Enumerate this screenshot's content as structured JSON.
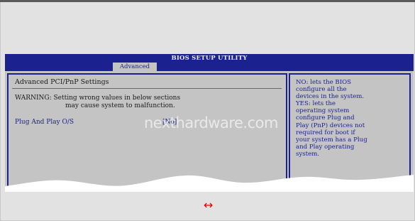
{
  "bios": {
    "title": "BIOS SETUP UTILITY",
    "active_tab": "Advanced",
    "heading": "Advanced PCI/PnP Settings",
    "warning_line1": "WARNING: Setting wrong values in below sections",
    "warning_line2": "may cause system to malfunction.",
    "setting_label": "Plug And Play O/S",
    "setting_value": "[No]",
    "help_lines": [
      "NO: lets the BIOS",
      "configure all the",
      "devices in the system.",
      "YES: lets the",
      "operating system",
      "configure Plug and",
      "Play (PnP) devices not",
      "required for boot if",
      "your system has a Plug",
      "and Play operating",
      "system."
    ]
  },
  "watermark": "nexthardware.com",
  "expand_icon": "↔",
  "colors": {
    "bios_blue": "#1b2290",
    "bios_gray": "#c4c4c4",
    "page_bg": "#e2e2e2",
    "arrow_red": "#e60000"
  }
}
